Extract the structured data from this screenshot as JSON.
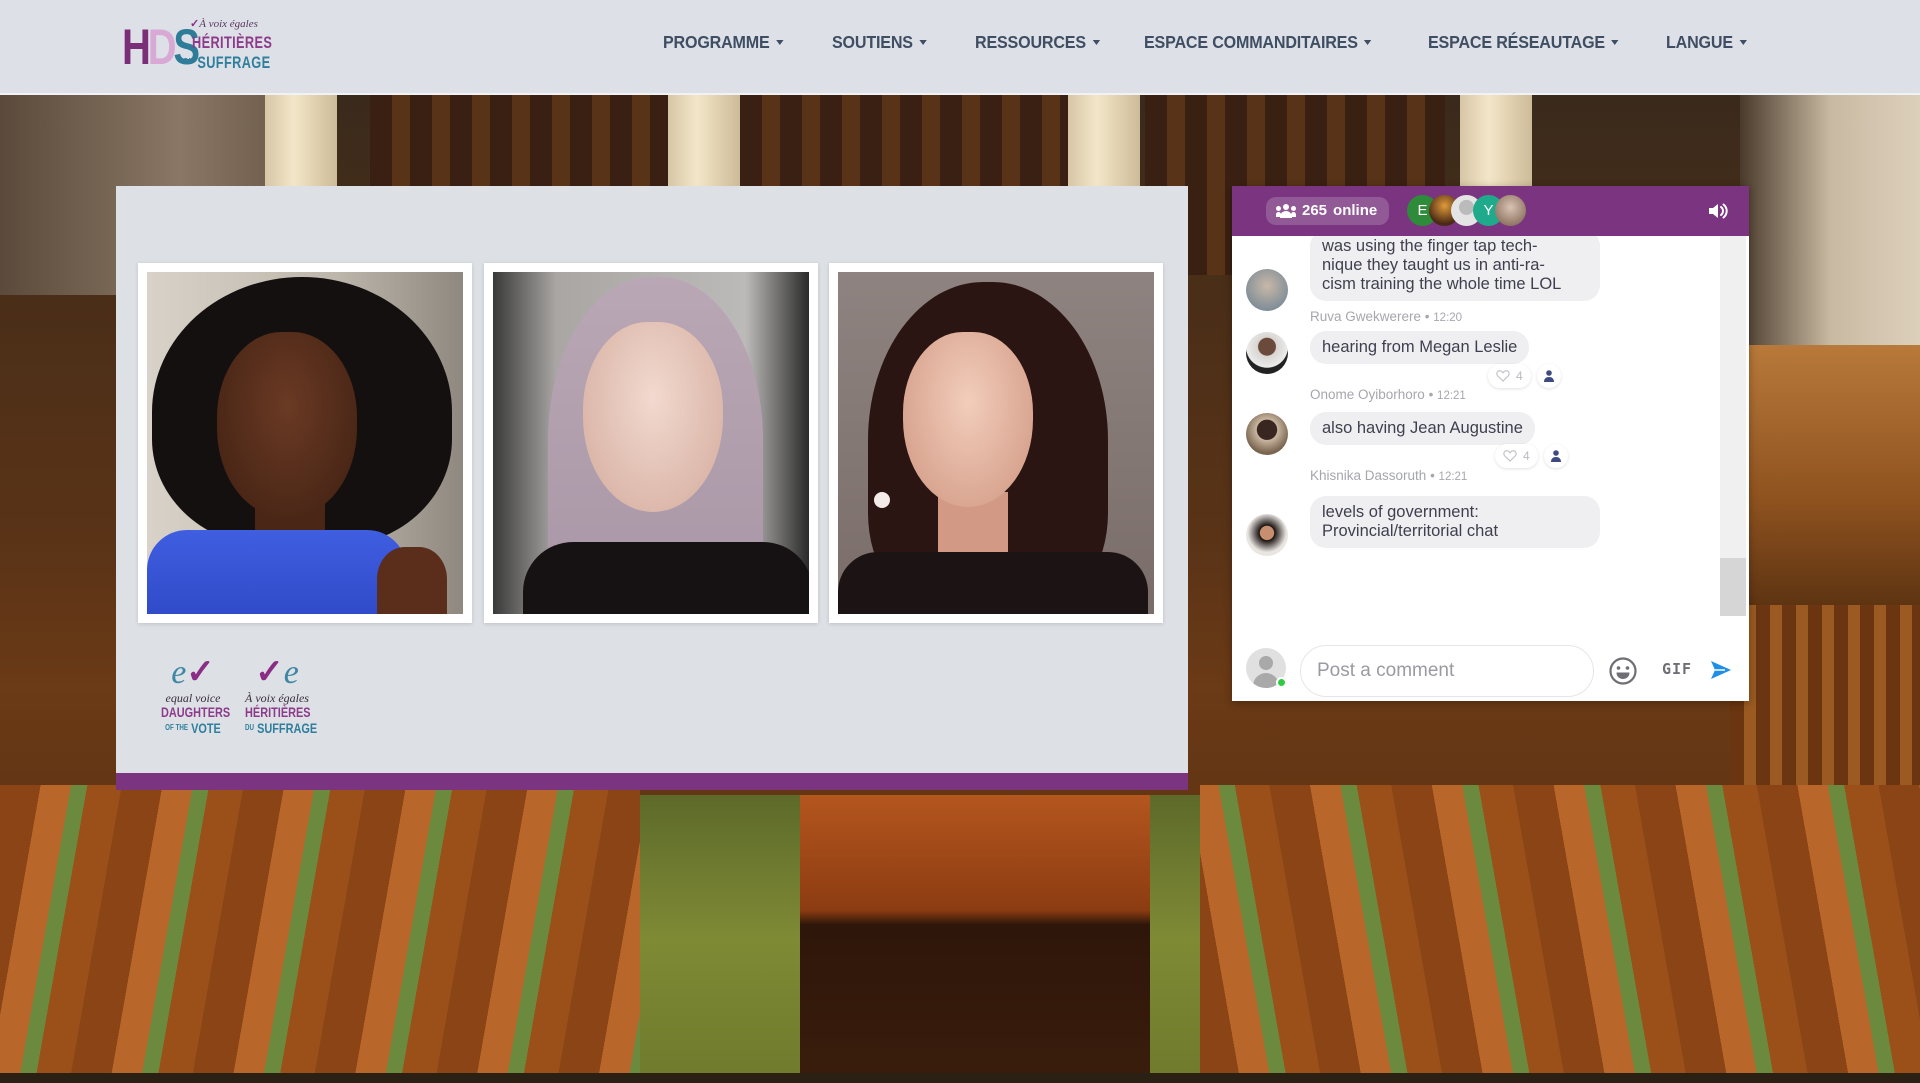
{
  "site": {
    "logo": {
      "monogram": [
        "H",
        "D",
        "S"
      ],
      "tagline": "À voix égales",
      "line1": "HÉRITIÈRES",
      "line2_prefix": "DU",
      "line2": "SUFFRAGE"
    },
    "nav": [
      {
        "label": "PROGRAMME",
        "has_dropdown": true
      },
      {
        "label": "SOUTIENS",
        "has_dropdown": true
      },
      {
        "label": "RESSOURCES",
        "has_dropdown": true
      },
      {
        "label": "ESPACE COMMANDITAIRES",
        "has_dropdown": true
      },
      {
        "label": "ESPACE RÉSEAUTAGE",
        "has_dropdown": true
      },
      {
        "label": "LANGUE",
        "has_dropdown": true
      }
    ],
    "colors": {
      "brand_purple": "#7b3580",
      "brand_teal": "#2e7e9c",
      "nav_text": "#3f4e63",
      "header_bg": "#dde1e7",
      "send_blue": "#1e8ee8",
      "online_green": "#2ecc40"
    }
  },
  "stage": {
    "participants": [
      {
        "label": "Participant 1 video"
      },
      {
        "label": "Participant 2 video"
      },
      {
        "label": "Participant 3 video"
      }
    ],
    "partner_logos": [
      {
        "mark_a": "e",
        "mark_b": "v",
        "subtitle": "equal voice",
        "line1": "DAUGHTERS",
        "line2_prefix": "OF THE",
        "line2": "VOTE"
      },
      {
        "mark_a": "v",
        "mark_b": "e",
        "subtitle": "À voix égales",
        "line1": "HÉRITIÈRES",
        "line2_prefix": "DU",
        "line2": "SUFFRAGE"
      }
    ]
  },
  "chat": {
    "online_count": "265",
    "online_label": "online",
    "header_avatars": [
      {
        "initial": "E",
        "color": "#2e8b3a"
      },
      {
        "initial": "",
        "color": "#c47a2a"
      },
      {
        "initial": "",
        "color": "#d5d5d5"
      },
      {
        "initial": "Y",
        "color": "#1faa8c"
      },
      {
        "initial": "",
        "color": "#b8a595"
      }
    ],
    "messages": [
      {
        "text": "was using the finger tap tech-\nnique they taught us in anti-ra-\ncism training the whole time LOL",
        "author": "Ruva Gwekwerere",
        "time": "12:20",
        "likes": null
      },
      {
        "text": "hearing from Megan Leslie",
        "author": "Onome Oyiborhoro",
        "time": "12:21",
        "likes": "4"
      },
      {
        "text": "also having Jean Augustine",
        "author": "Khisnika Dassoruth",
        "time": "12:21",
        "likes": "4"
      },
      {
        "text": "levels of government:\nProvincial/territorial chat",
        "author": null,
        "time": null,
        "likes": null
      }
    ],
    "meta_separator": " • ",
    "composer": {
      "placeholder": "Post a comment",
      "gif_label": "GIF"
    }
  }
}
